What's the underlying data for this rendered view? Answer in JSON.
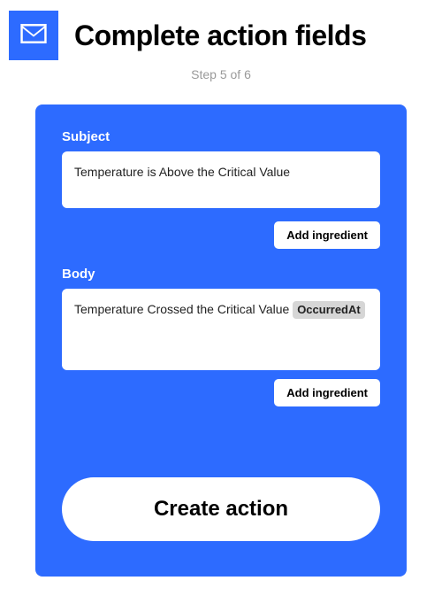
{
  "header": {
    "title": "Complete action fields",
    "step_indicator": "Step 5 of 6"
  },
  "fields": {
    "subject": {
      "label": "Subject",
      "value": "Temperature is Above the Critical Value",
      "add_ingredient_label": "Add ingredient"
    },
    "body": {
      "label": "Body",
      "text_before": "Temperature Crossed the Critical Value ",
      "ingredient": "OccurredAt",
      "add_ingredient_label": "Add ingredient"
    }
  },
  "actions": {
    "create_label": "Create action"
  }
}
